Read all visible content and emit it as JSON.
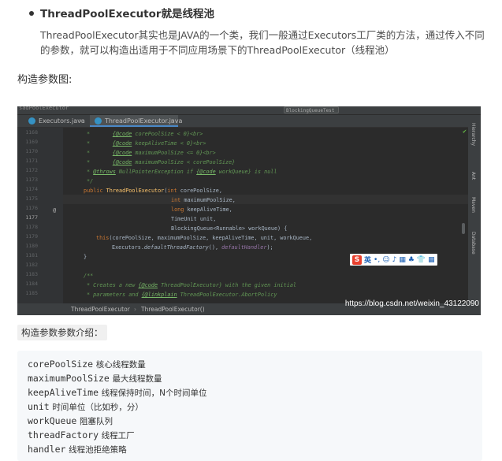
{
  "section": {
    "title": "ThreadPoolExecutor就是线程池",
    "body": "ThreadPoolExecutor其实也是JAVA的一个类，我们一般通过Executors工厂类的方法，通过传入不同的参数，就可以构造出适用于不同应用场景下的ThreadPoolExecutor（线程池）",
    "diagram_label": "构造参数图:"
  },
  "ide": {
    "title_left": "sadPoolExecutor",
    "title_right": "BlockingQueueTest",
    "tabs": [
      {
        "label": "Executors.java",
        "close": "×"
      },
      {
        "label": "ThreadPoolExecutor.java",
        "close": "×"
      }
    ],
    "line_numbers": [
      "1168",
      "1169",
      "1170",
      "1171",
      "1172",
      "1173",
      "1174",
      "1175",
      "1176",
      "1177",
      "1178",
      "1179",
      "1180",
      "1181",
      "1182",
      "1183",
      "1184",
      "1185"
    ],
    "gutter_marker": "@",
    "code": {
      "l0a": "*       ",
      "l0b": "{@code",
      "l0c": " corePoolSize < 0}<br>",
      "l1a": "*       ",
      "l1b": "{@code",
      "l1c": " keepAliveTime < 0}<br>",
      "l2a": "*       ",
      "l2b": "{@code",
      "l2c": " maximumPoolSize <= 0}<br>",
      "l3a": "*       ",
      "l3b": "{@code",
      "l3c": " maximumPoolSize < corePoolSize}",
      "l4a": "* ",
      "l4b": "@throws",
      "l4c": " NullPointerException if ",
      "l4d": "{@code",
      "l4e": " workQueue} is null",
      "l5": "*/",
      "l6a": "public ",
      "l6b": "ThreadPoolExecutor",
      "l6c": "(",
      "l6d": "int",
      "l6e": " corePoolSize,",
      "l7a": "int",
      "l7b": " maximumPoolSize,",
      "l8a": "long",
      "l8b": " keepAliveTime,",
      "l9": "TimeUnit unit,",
      "l10": "BlockingQueue<Runnable> workQueue) {",
      "l11a": "this",
      "l11b": "(corePoolSize, maximumPoolSize, keepAliveTime, unit, workQueue,",
      "l12a": "Executors.",
      "l12b": "defaultThreadFactory",
      "l12c": "(), ",
      "l12d": "defaultHandler",
      "l12e": ");",
      "l13": "}",
      "l15": "/**",
      "l16a": "* Creates a new ",
      "l16b": "{@code",
      "l16c": " ThreadPoolExecutor} with the given initial",
      "l17a": "* parameters and ",
      "l17b": "{@linkplain",
      "l17c": " ThreadPoolExecutor.AbortPolicy"
    },
    "right_panels": [
      "Hierarchy",
      "Ant",
      "Maven",
      "Database"
    ],
    "ime": {
      "logo": "S",
      "lang": "英",
      "icons": [
        "•,",
        "☺",
        "♪",
        "▦",
        "♣",
        "👕",
        "▦"
      ]
    },
    "status_crumbs": [
      "ThreadPoolExecutor",
      "ThreadPoolExecutor()"
    ],
    "crumb_separator": "›",
    "watermark": "https://blog.csdn.net/weixin_43122090"
  },
  "params_label": "构造参数参数介绍：",
  "params": [
    {
      "name": "corePoolSize",
      "desc": "核心线程数量"
    },
    {
      "name": "maximumPoolSize",
      "desc": "最大线程数量"
    },
    {
      "name": "keepAliveTime",
      "desc": "线程保持时间，N个时间单位"
    },
    {
      "name": "unit",
      "desc": "时间单位（比如秒，分）"
    },
    {
      "name": "workQueue",
      "desc": "阻塞队列"
    },
    {
      "name": "threadFactory",
      "desc": "线程工厂"
    },
    {
      "name": "handler",
      "desc": "线程池拒绝策略"
    }
  ]
}
